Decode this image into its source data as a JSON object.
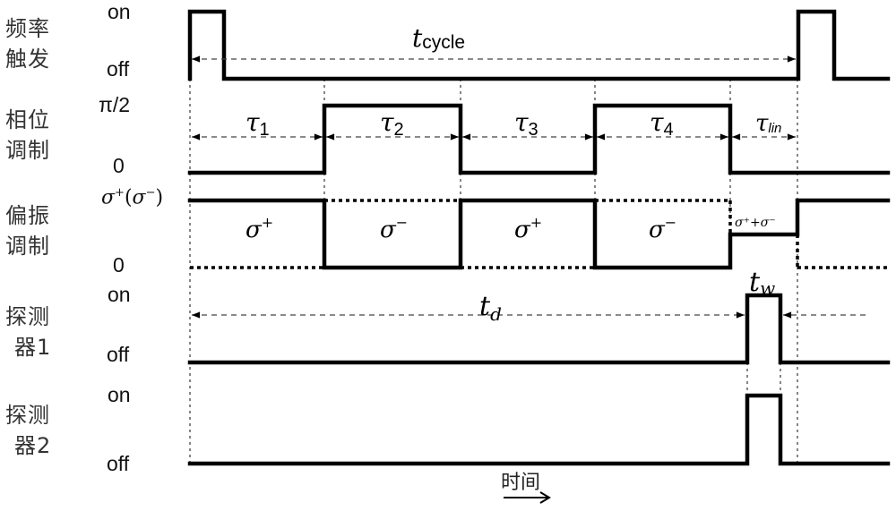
{
  "rows": [
    {
      "name": "频率触发",
      "line1": "频率",
      "line2": "触发",
      "high_label": "on",
      "low_label": "off"
    },
    {
      "name": "相位调制",
      "line1": "相位",
      "line2": "调制",
      "high_label": "π/2",
      "low_label": "0"
    },
    {
      "name": "偏振调制",
      "line1": "偏振",
      "line2": "调制",
      "high_label": "σ⁺(σ⁻)",
      "low_label": "0"
    },
    {
      "name": "探测器1",
      "line1": "探测",
      "line2": "器1",
      "high_label": "on",
      "low_label": "off"
    },
    {
      "name": "探测器2",
      "line1": "探测",
      "line2": "器2",
      "high_label": "on",
      "low_label": "off"
    }
  ],
  "intervals": {
    "cycle": {
      "base": "t",
      "sub": "cycle"
    },
    "tau1": {
      "base": "τ",
      "sub": "1"
    },
    "tau2": {
      "base": "τ",
      "sub": "2"
    },
    "tau3": {
      "base": "τ",
      "sub": "3"
    },
    "tau4": {
      "base": "τ",
      "sub": "4"
    },
    "tau_lin": {
      "base": "τ",
      "sub": "lin"
    },
    "td": {
      "base": "t",
      "sub": "d"
    },
    "tw": {
      "base": "t",
      "sub": "w"
    }
  },
  "polarization_states": {
    "seg1": {
      "base": "σ",
      "sup": "+"
    },
    "seg2": {
      "base": "σ",
      "sup": "−"
    },
    "seg3": {
      "base": "σ",
      "sup": "+"
    },
    "seg4": {
      "base": "σ",
      "sup": "−"
    },
    "seg5": "σ⁺+σ⁻"
  },
  "time_axis_label": "时间",
  "time_axis_arrow": "→"
}
